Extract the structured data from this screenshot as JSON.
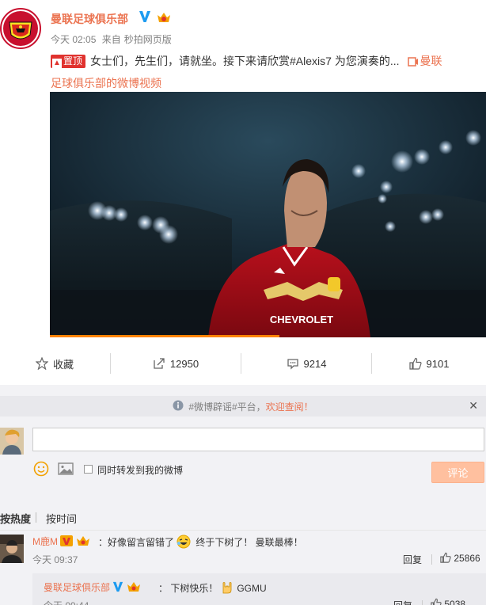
{
  "post": {
    "username": "曼联足球俱乐部",
    "time": "今天 02:05",
    "source_prefix": "来自",
    "source": "秒拍网页版",
    "pin_label": "置顶",
    "text": "女士们，先生们，请就坐。接下来请欣赏#Alexis7 为您演奏的...",
    "video_link_line1": "曼联",
    "video_link_line2": "足球俱乐部的微博视频"
  },
  "actions": {
    "favorite": "收藏",
    "repost": "12950",
    "comment": "9214",
    "like": "9101"
  },
  "notice": {
    "text": "#微博辟谣#平台，",
    "link": "欢迎查阅！"
  },
  "composer": {
    "repost_label": "同时转发到我的微博",
    "submit_label": "评论"
  },
  "sort": {
    "hot": "按热度",
    "time": "按时间"
  },
  "comments": [
    {
      "user": "M鹿M",
      "text_a": "：好像留言留错了",
      "text_b": " 终于下树了！ 曼联最棒！",
      "time": "今天 09:37",
      "reply_label": "回复",
      "likes": "25866"
    },
    {
      "user": "曼联足球俱乐部",
      "text_a": "： 下树快乐！",
      "text_b": "GGMU",
      "time": "今天 09:44",
      "reply_label": "回复",
      "likes": "5038"
    }
  ],
  "colors": {
    "accent": "#eb7350",
    "pin": "#e0332f",
    "progress": "#ff8200",
    "submit_disabled": "#ffc09f"
  }
}
